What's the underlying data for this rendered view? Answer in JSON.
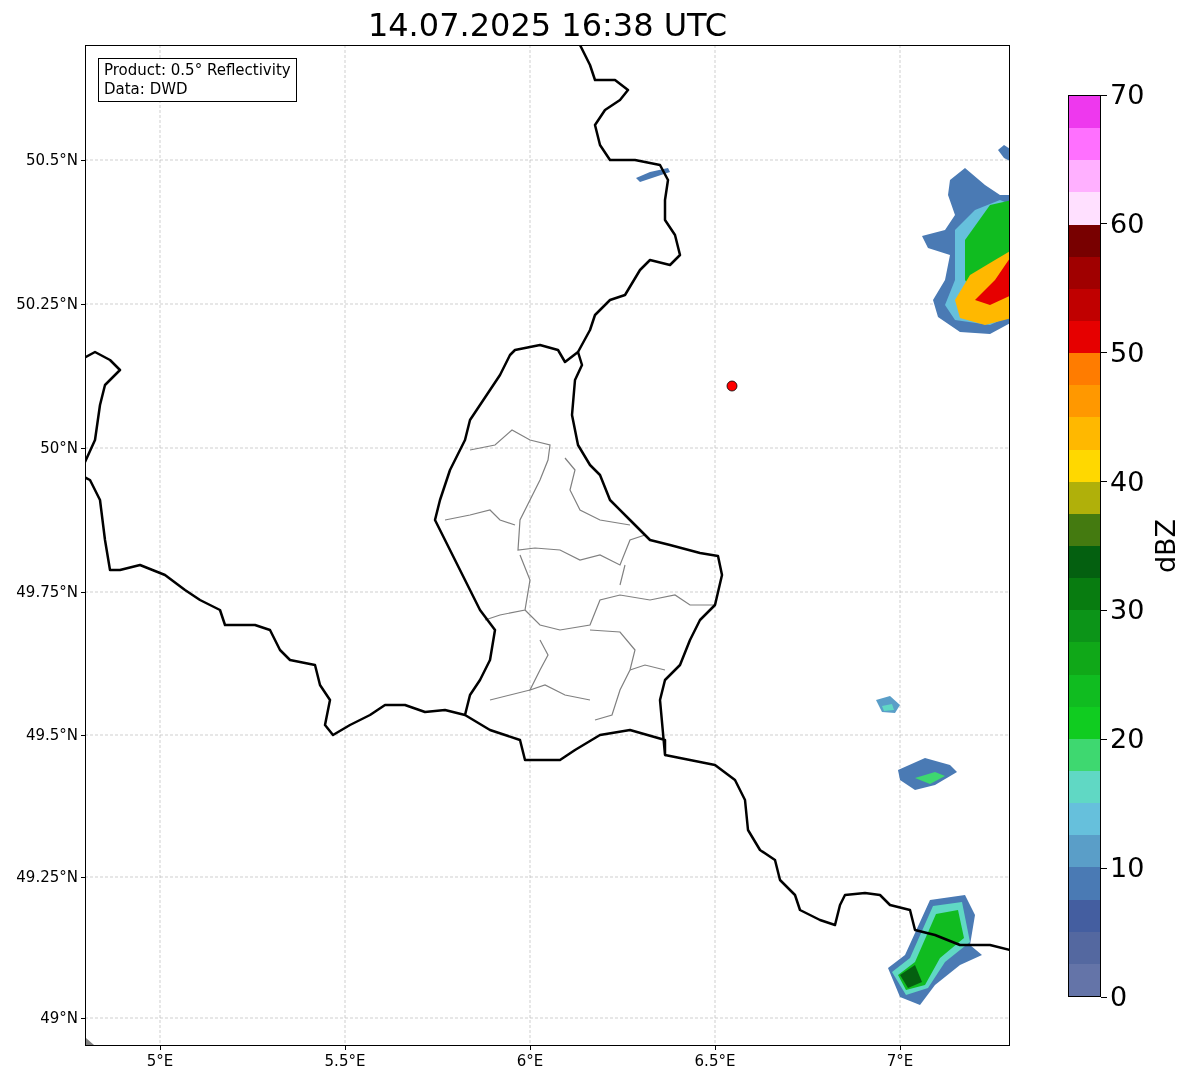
{
  "title": "14.07.2025 16:38 UTC",
  "info_box": {
    "lines": [
      "Product: 0.5° Reflectivity",
      "Data: DWD"
    ]
  },
  "map": {
    "lat_ticks": [
      "50.5°N",
      "50.25°N",
      "50°N",
      "49.75°N",
      "49.5°N",
      "49.25°N",
      "49°N"
    ],
    "lon_ticks": [
      "5°E",
      "5.5°E",
      "6°E",
      "6.5°E",
      "7°E"
    ]
  },
  "colorbar": {
    "label": "dBZ",
    "ticks": [
      "70",
      "60",
      "50",
      "40",
      "30",
      "20",
      "10",
      "0"
    ],
    "bands": [
      {
        "color": "#ee38ee"
      },
      {
        "color": "#ff70ff"
      },
      {
        "color": "#ffb0ff"
      },
      {
        "color": "#ffe0ff"
      },
      {
        "color": "#780000"
      },
      {
        "color": "#a00000"
      },
      {
        "color": "#c00000"
      },
      {
        "color": "#e60000"
      },
      {
        "color": "#ff7c00"
      },
      {
        "color": "#ff9800"
      },
      {
        "color": "#ffb800"
      },
      {
        "color": "#ffd800"
      },
      {
        "color": "#b0b00a"
      },
      {
        "color": "#447a10"
      },
      {
        "color": "#046010"
      },
      {
        "color": "#087c10"
      },
      {
        "color": "#0c9418"
      },
      {
        "color": "#10a818"
      },
      {
        "color": "#10bc20"
      },
      {
        "color": "#10cc20"
      },
      {
        "color": "#3ed870"
      },
      {
        "color": "#60d8c4"
      },
      {
        "color": "#66c0dc"
      },
      {
        "color": "#5a9ec8"
      },
      {
        "color": "#4a7ab4"
      },
      {
        "color": "#445ea0"
      },
      {
        "color": "#5468a0"
      },
      {
        "color": "#6474a8"
      }
    ]
  }
}
